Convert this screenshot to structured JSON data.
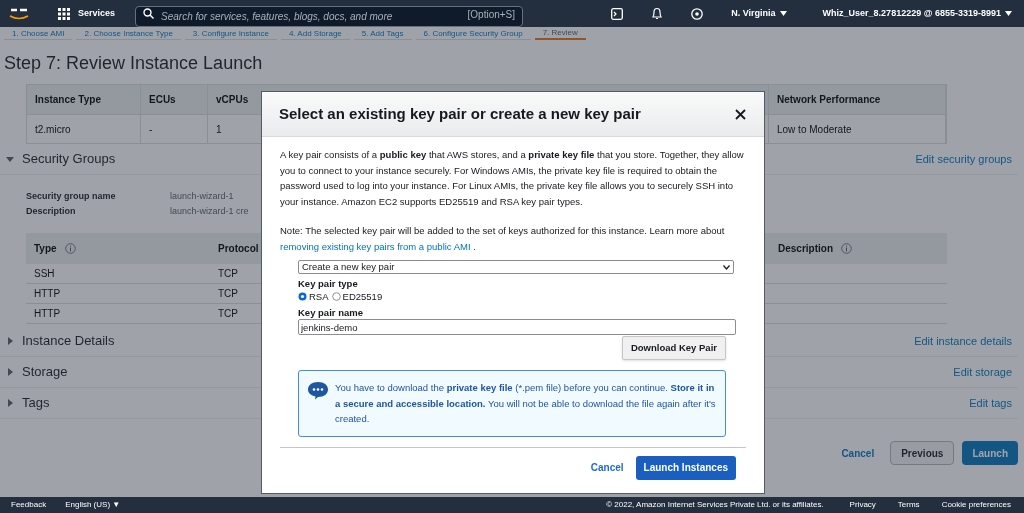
{
  "top_nav": {
    "services": "Services",
    "search_placeholder": "Search for services, features, blogs, docs, and more",
    "shortcut": "[Option+S]",
    "region": "N. Virginia",
    "account": "Whiz_User_8.27812229 @ 6855-3319-8991"
  },
  "steps": [
    {
      "label": "1. Choose AMI",
      "selected": false
    },
    {
      "label": "2. Choose Instance Type",
      "selected": false
    },
    {
      "label": "3. Configure Instance",
      "selected": false
    },
    {
      "label": "4. Add Storage",
      "selected": false
    },
    {
      "label": "5. Add Tags",
      "selected": false
    },
    {
      "label": "6. Configure Security Group",
      "selected": false
    },
    {
      "label": "7. Review",
      "selected": true
    }
  ],
  "page_title": "Step 7: Review Instance Launch",
  "instance_table": {
    "columns": [
      "Instance Type",
      "ECUs",
      "vCPUs",
      "Network Performance"
    ],
    "rows": [
      [
        "t2.micro",
        "-",
        "1",
        "Low to Moderate"
      ]
    ]
  },
  "sections": [
    {
      "title": "Security Groups",
      "expanded": true,
      "edit_link": "Edit security groups"
    },
    {
      "title": "Instance Details",
      "expanded": false,
      "edit_link": "Edit instance details"
    },
    {
      "title": "Storage",
      "expanded": false,
      "edit_link": "Edit storage"
    },
    {
      "title": "Tags",
      "expanded": false,
      "edit_link": "Edit tags"
    }
  ],
  "security_group": {
    "fields": [
      {
        "label": "Security group name",
        "value": "launch-wizard-1"
      },
      {
        "label": "Description",
        "value": "launch-wizard-1 cre"
      }
    ],
    "rules": {
      "columns": [
        "Type",
        "Protocol",
        "Description"
      ],
      "rows": [
        [
          "SSH",
          "TCP"
        ],
        [
          "HTTP",
          "TCP"
        ],
        [
          "HTTP",
          "TCP"
        ]
      ]
    }
  },
  "page_actions": {
    "cancel": "Cancel",
    "previous": "Previous",
    "launch": "Launch"
  },
  "modal": {
    "title": "Select an existing key pair or create a new key pair",
    "intro": "A key pair consists of a **public key** that AWS stores, and a **private key file** that you store. Together, they allow you to connect to your instance securely. For Windows AMIs, the private key file is required to obtain the password used to log into your instance. For Linux AMIs, the private key file allows you to securely SSH into your instance. Amazon EC2 supports ED25519 and RSA key pair types.",
    "note": "Note: The selected key pair will be added to the set of keys authorized for this instance. Learn more about",
    "note_link": "removing existing key pairs from a public AMI",
    "note_end": ".",
    "key_pair_option": "Create a new key pair",
    "type_label": "Key pair type",
    "types": [
      {
        "label": "RSA",
        "selected": true
      },
      {
        "label": "ED25519",
        "selected": false
      }
    ],
    "name_label": "Key pair name",
    "name_value": "jenkins-demo",
    "download": "Download Key Pair",
    "info": "You have to download the **private key file** (*.pem file) before you can continue. **Store it in a secure and accessible location.** You will not be able to download the file again after it's created.",
    "cancel": "Cancel",
    "launch": "Launch Instances"
  },
  "footer": {
    "feedback": "Feedback",
    "language": "English (US) ▼",
    "copyright": "© 2022, Amazon Internet Services Private Ltd. or its affiliates.",
    "links": [
      "Privacy",
      "Terms",
      "Cookie preferences"
    ]
  }
}
